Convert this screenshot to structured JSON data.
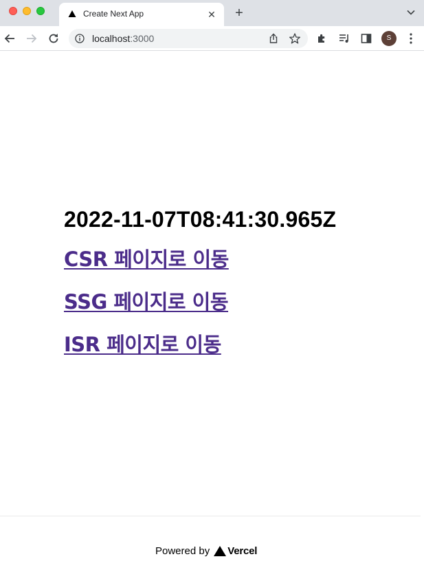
{
  "browser": {
    "tab": {
      "title": "Create Next App",
      "close_glyph": "✕"
    },
    "new_tab_glyph": "+",
    "omnibox": {
      "host": "localhost",
      "port": ":3000"
    },
    "profile_initial": "S"
  },
  "page": {
    "timestamp": "2022-11-07T08:41:30.965Z",
    "links": [
      {
        "label": "CSR 페이지로 이동"
      },
      {
        "label": "SSG 페이지로 이동"
      },
      {
        "label": "ISR 페이지로 이동"
      }
    ],
    "footer": {
      "powered_by": "Powered by",
      "brand": "Vercel"
    }
  },
  "colors": {
    "link": "#4b2c8a",
    "tabstrip": "#dee1e6",
    "profile_bg": "#5d4037"
  }
}
